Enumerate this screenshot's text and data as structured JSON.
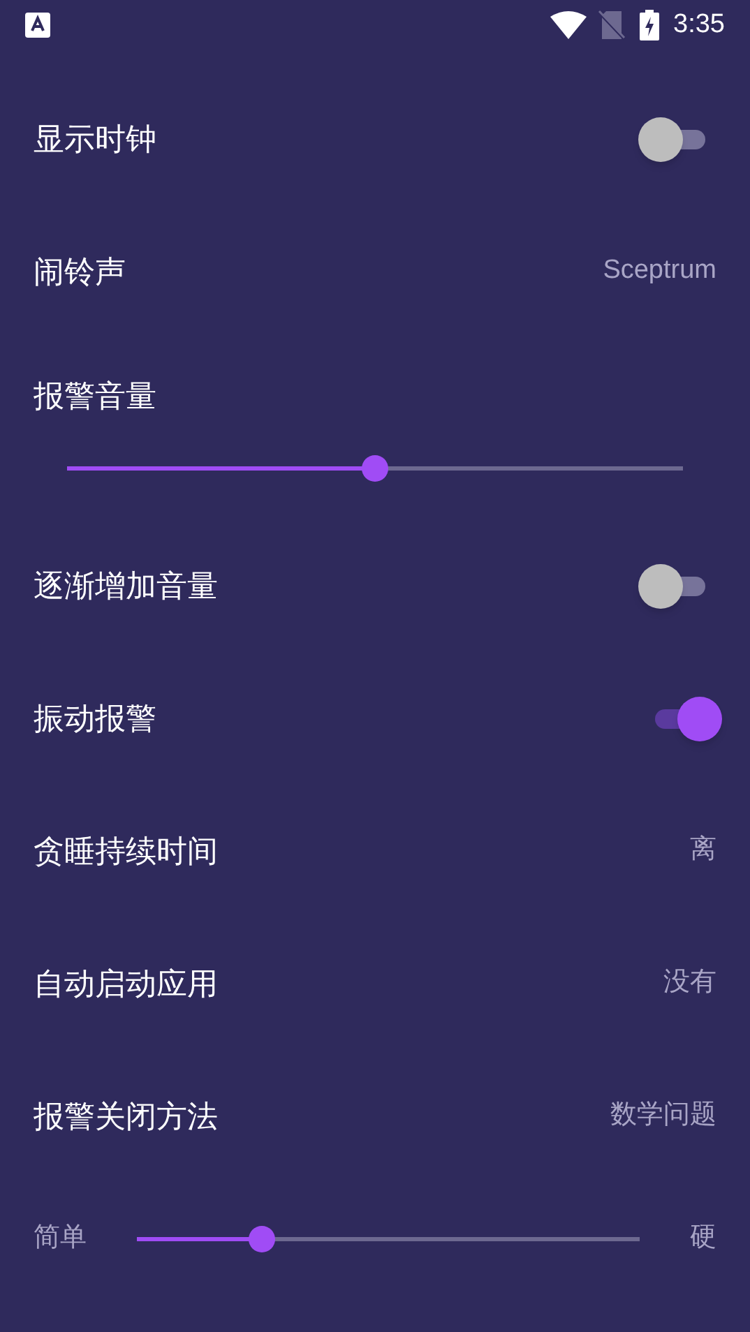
{
  "status_bar": {
    "time": "3:35"
  },
  "settings": [
    {
      "kind": "toggle",
      "label": "显示时钟",
      "on": false
    },
    {
      "kind": "value",
      "label": "闹铃声",
      "value": "Sceptrum"
    },
    {
      "kind": "slider",
      "label": "报警音量",
      "level": 0.5
    },
    {
      "kind": "toggle",
      "label": "逐渐增加音量",
      "on": false
    },
    {
      "kind": "toggle",
      "label": "振动报警",
      "on": true
    },
    {
      "kind": "value",
      "label": "贪睡持续时间",
      "value": "离"
    },
    {
      "kind": "value",
      "label": "自动启动应用",
      "value": "没有"
    },
    {
      "kind": "value",
      "label": "报警关闭方法",
      "value": "数学问题"
    },
    {
      "kind": "range",
      "min_label": "简单",
      "max_label": "硬",
      "level": 0.25
    }
  ]
}
